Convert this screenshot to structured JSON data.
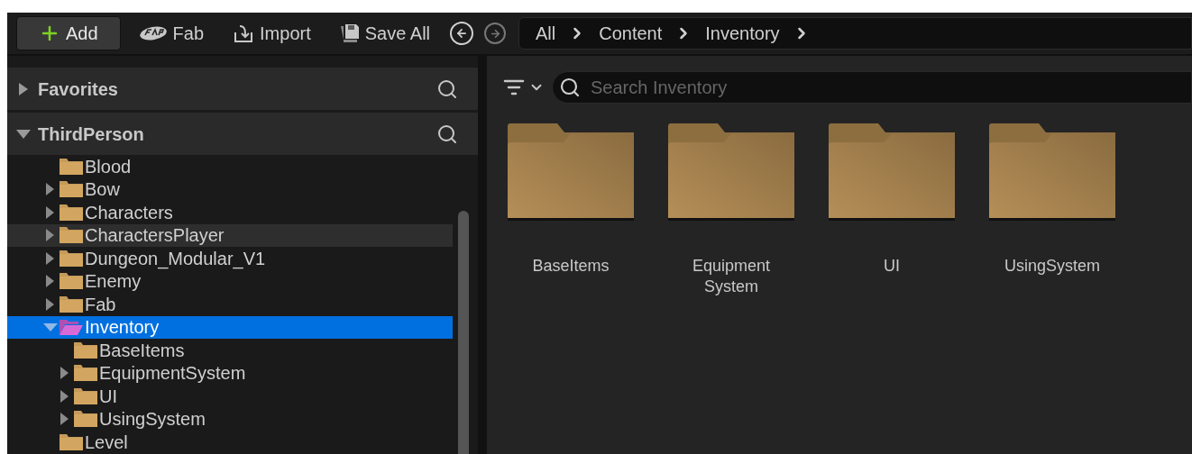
{
  "toolbar": {
    "buttons": [
      {
        "kind": "add",
        "label": "Add"
      },
      {
        "kind": "fab",
        "label": "Fab"
      },
      {
        "kind": "import",
        "label": "Import"
      },
      {
        "kind": "save",
        "label": "Save All"
      }
    ]
  },
  "navigation": {
    "back_enabled": true,
    "forward_enabled": false
  },
  "breadcrumbs": [
    "All",
    "Content",
    "Inventory"
  ],
  "sidebar": {
    "sections": [
      {
        "title": "Favorites",
        "expanded": false
      },
      {
        "title": "ThirdPerson",
        "expanded": true
      }
    ],
    "tree": [
      {
        "label": "Blood",
        "kind": "leaf",
        "expanded": false,
        "selected": false,
        "hovered": false
      },
      {
        "label": "Bow",
        "kind": "branch",
        "expanded": false,
        "selected": false,
        "hovered": false
      },
      {
        "label": "Characters",
        "kind": "branch",
        "expanded": false,
        "selected": false,
        "hovered": false
      },
      {
        "label": "CharactersPlayer",
        "kind": "branch",
        "expanded": false,
        "selected": false,
        "hovered": true
      },
      {
        "label": "Dungeon_Modular_V1",
        "kind": "branch",
        "expanded": false,
        "selected": false,
        "hovered": false
      },
      {
        "label": "Enemy",
        "kind": "branch",
        "expanded": false,
        "selected": false,
        "hovered": false
      },
      {
        "label": "Fab",
        "kind": "branch",
        "expanded": false,
        "selected": false,
        "hovered": false
      },
      {
        "label": "Inventory",
        "kind": "branch",
        "expanded": true,
        "selected": true,
        "hovered": false,
        "children": [
          {
            "label": "BaseItems",
            "kind": "leaf",
            "expanded": false,
            "selected": false,
            "hovered": false
          },
          {
            "label": "EquipmentSystem",
            "kind": "branch",
            "expanded": false,
            "selected": false,
            "hovered": false
          },
          {
            "label": "UI",
            "kind": "branch",
            "expanded": false,
            "selected": false,
            "hovered": false
          },
          {
            "label": "UsingSystem",
            "kind": "branch",
            "expanded": false,
            "selected": false,
            "hovered": false
          }
        ]
      },
      {
        "label": "Level",
        "kind": "leaf",
        "expanded": false,
        "selected": false,
        "hovered": false
      }
    ]
  },
  "content": {
    "search": {
      "placeholder": "Search Inventory"
    },
    "folders": [
      {
        "name": "BaseItems"
      },
      {
        "name": "Equipment System"
      },
      {
        "name": "UI"
      },
      {
        "name": "UsingSystem"
      }
    ]
  }
}
